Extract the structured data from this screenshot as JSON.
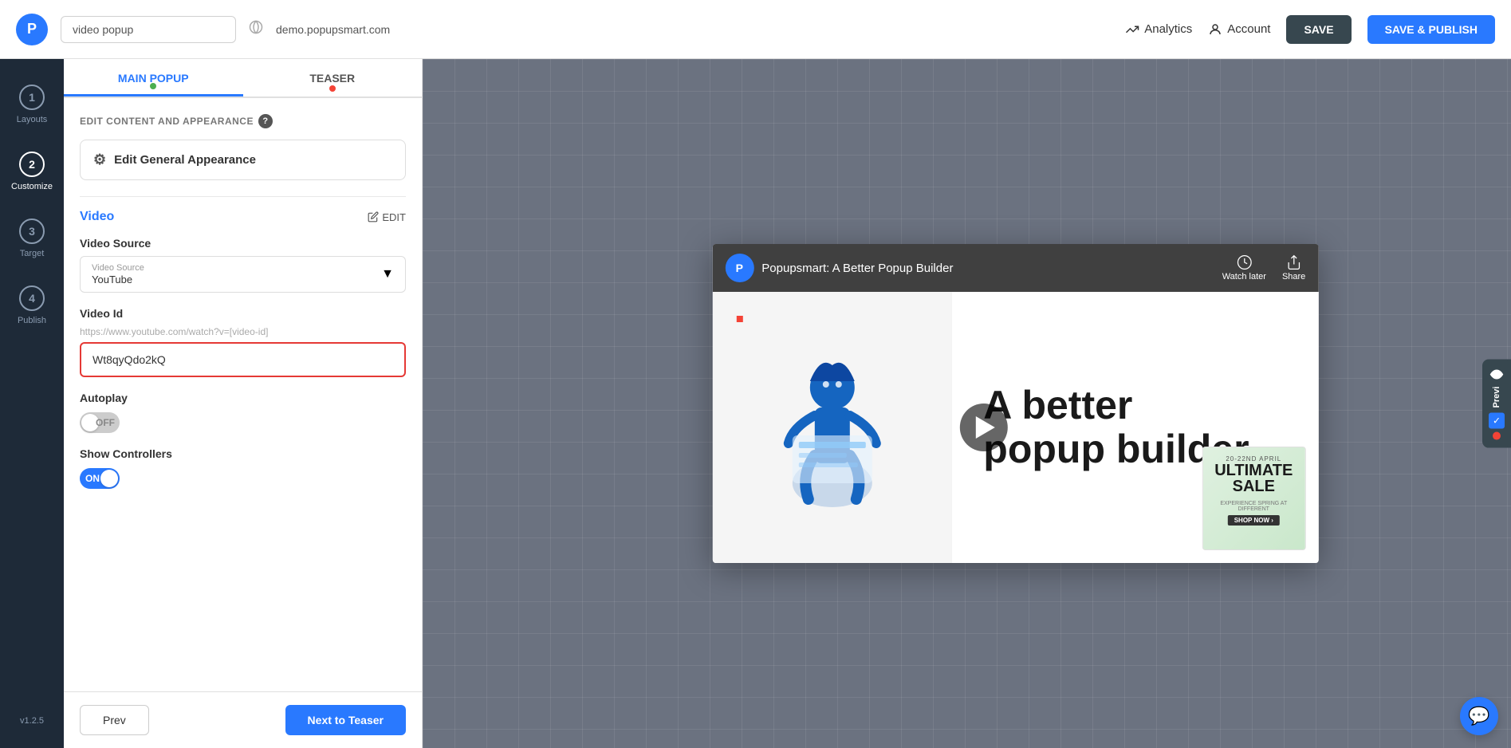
{
  "topbar": {
    "logo_text": "P",
    "search_value": "video popup",
    "url_value": "demo.popupsmart.com",
    "analytics_label": "Analytics",
    "account_label": "Account",
    "save_label": "SAVE",
    "save_publish_label": "SAVE & PUBLISH"
  },
  "steps": [
    {
      "number": "1",
      "label": "Layouts"
    },
    {
      "number": "2",
      "label": "Customize",
      "active": true
    },
    {
      "number": "3",
      "label": "Target"
    },
    {
      "number": "4",
      "label": "Publish"
    }
  ],
  "version": "v1.2.5",
  "panel": {
    "tabs": [
      {
        "label": "MAIN POPUP",
        "dot": "green",
        "active": true
      },
      {
        "label": "TEASER",
        "dot": "red",
        "active": false
      }
    ],
    "section_label": "EDIT CONTENT AND APPEARANCE",
    "edit_appearance_btn": "Edit General Appearance",
    "video_section_title": "Video",
    "edit_link_label": "EDIT",
    "video_source_label": "Video Source",
    "video_source_inner_label": "Video Source",
    "video_source_value": "YouTube",
    "video_id_label": "Video Id",
    "video_id_hint": "https://www.youtube.com/watch?v=[video-id]",
    "video_id_value": "Wt8qyQdo2kQ",
    "autoplay_label": "Autoplay",
    "autoplay_state": "OFF",
    "controllers_label": "Show Controllers",
    "controllers_state": "ON"
  },
  "footer": {
    "prev_label": "Prev",
    "next_label": "Next to Teaser"
  },
  "popup": {
    "yt_logo": "P",
    "video_title": "Popupsmart: A Better Popup Builder",
    "watch_later_label": "Watch later",
    "share_label": "Share",
    "thumb_text_line1": "A better",
    "thumb_text_line2": "popup builder.",
    "close_label": "✕"
  }
}
